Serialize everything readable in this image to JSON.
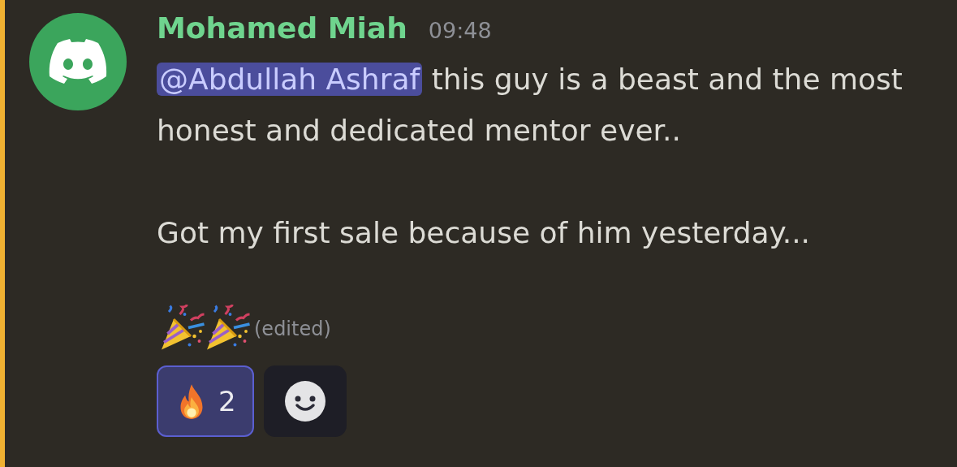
{
  "message": {
    "author": "Mohamed Miah",
    "timestamp": "09:48",
    "mentions_you": true,
    "paragraphs": [
      [
        {
          "kind": "mention",
          "text": "@Abdullah Ashraf"
        },
        {
          "kind": "text",
          "text": " this guy is a beast and the most honest and dedicated mentor ever.."
        }
      ],
      [
        {
          "kind": "text",
          "text": "Got my first sale because of him yesterday..."
        }
      ]
    ],
    "edited_label": "(edited)",
    "reactions": [
      {
        "count": "2",
        "selected": true
      }
    ]
  }
}
